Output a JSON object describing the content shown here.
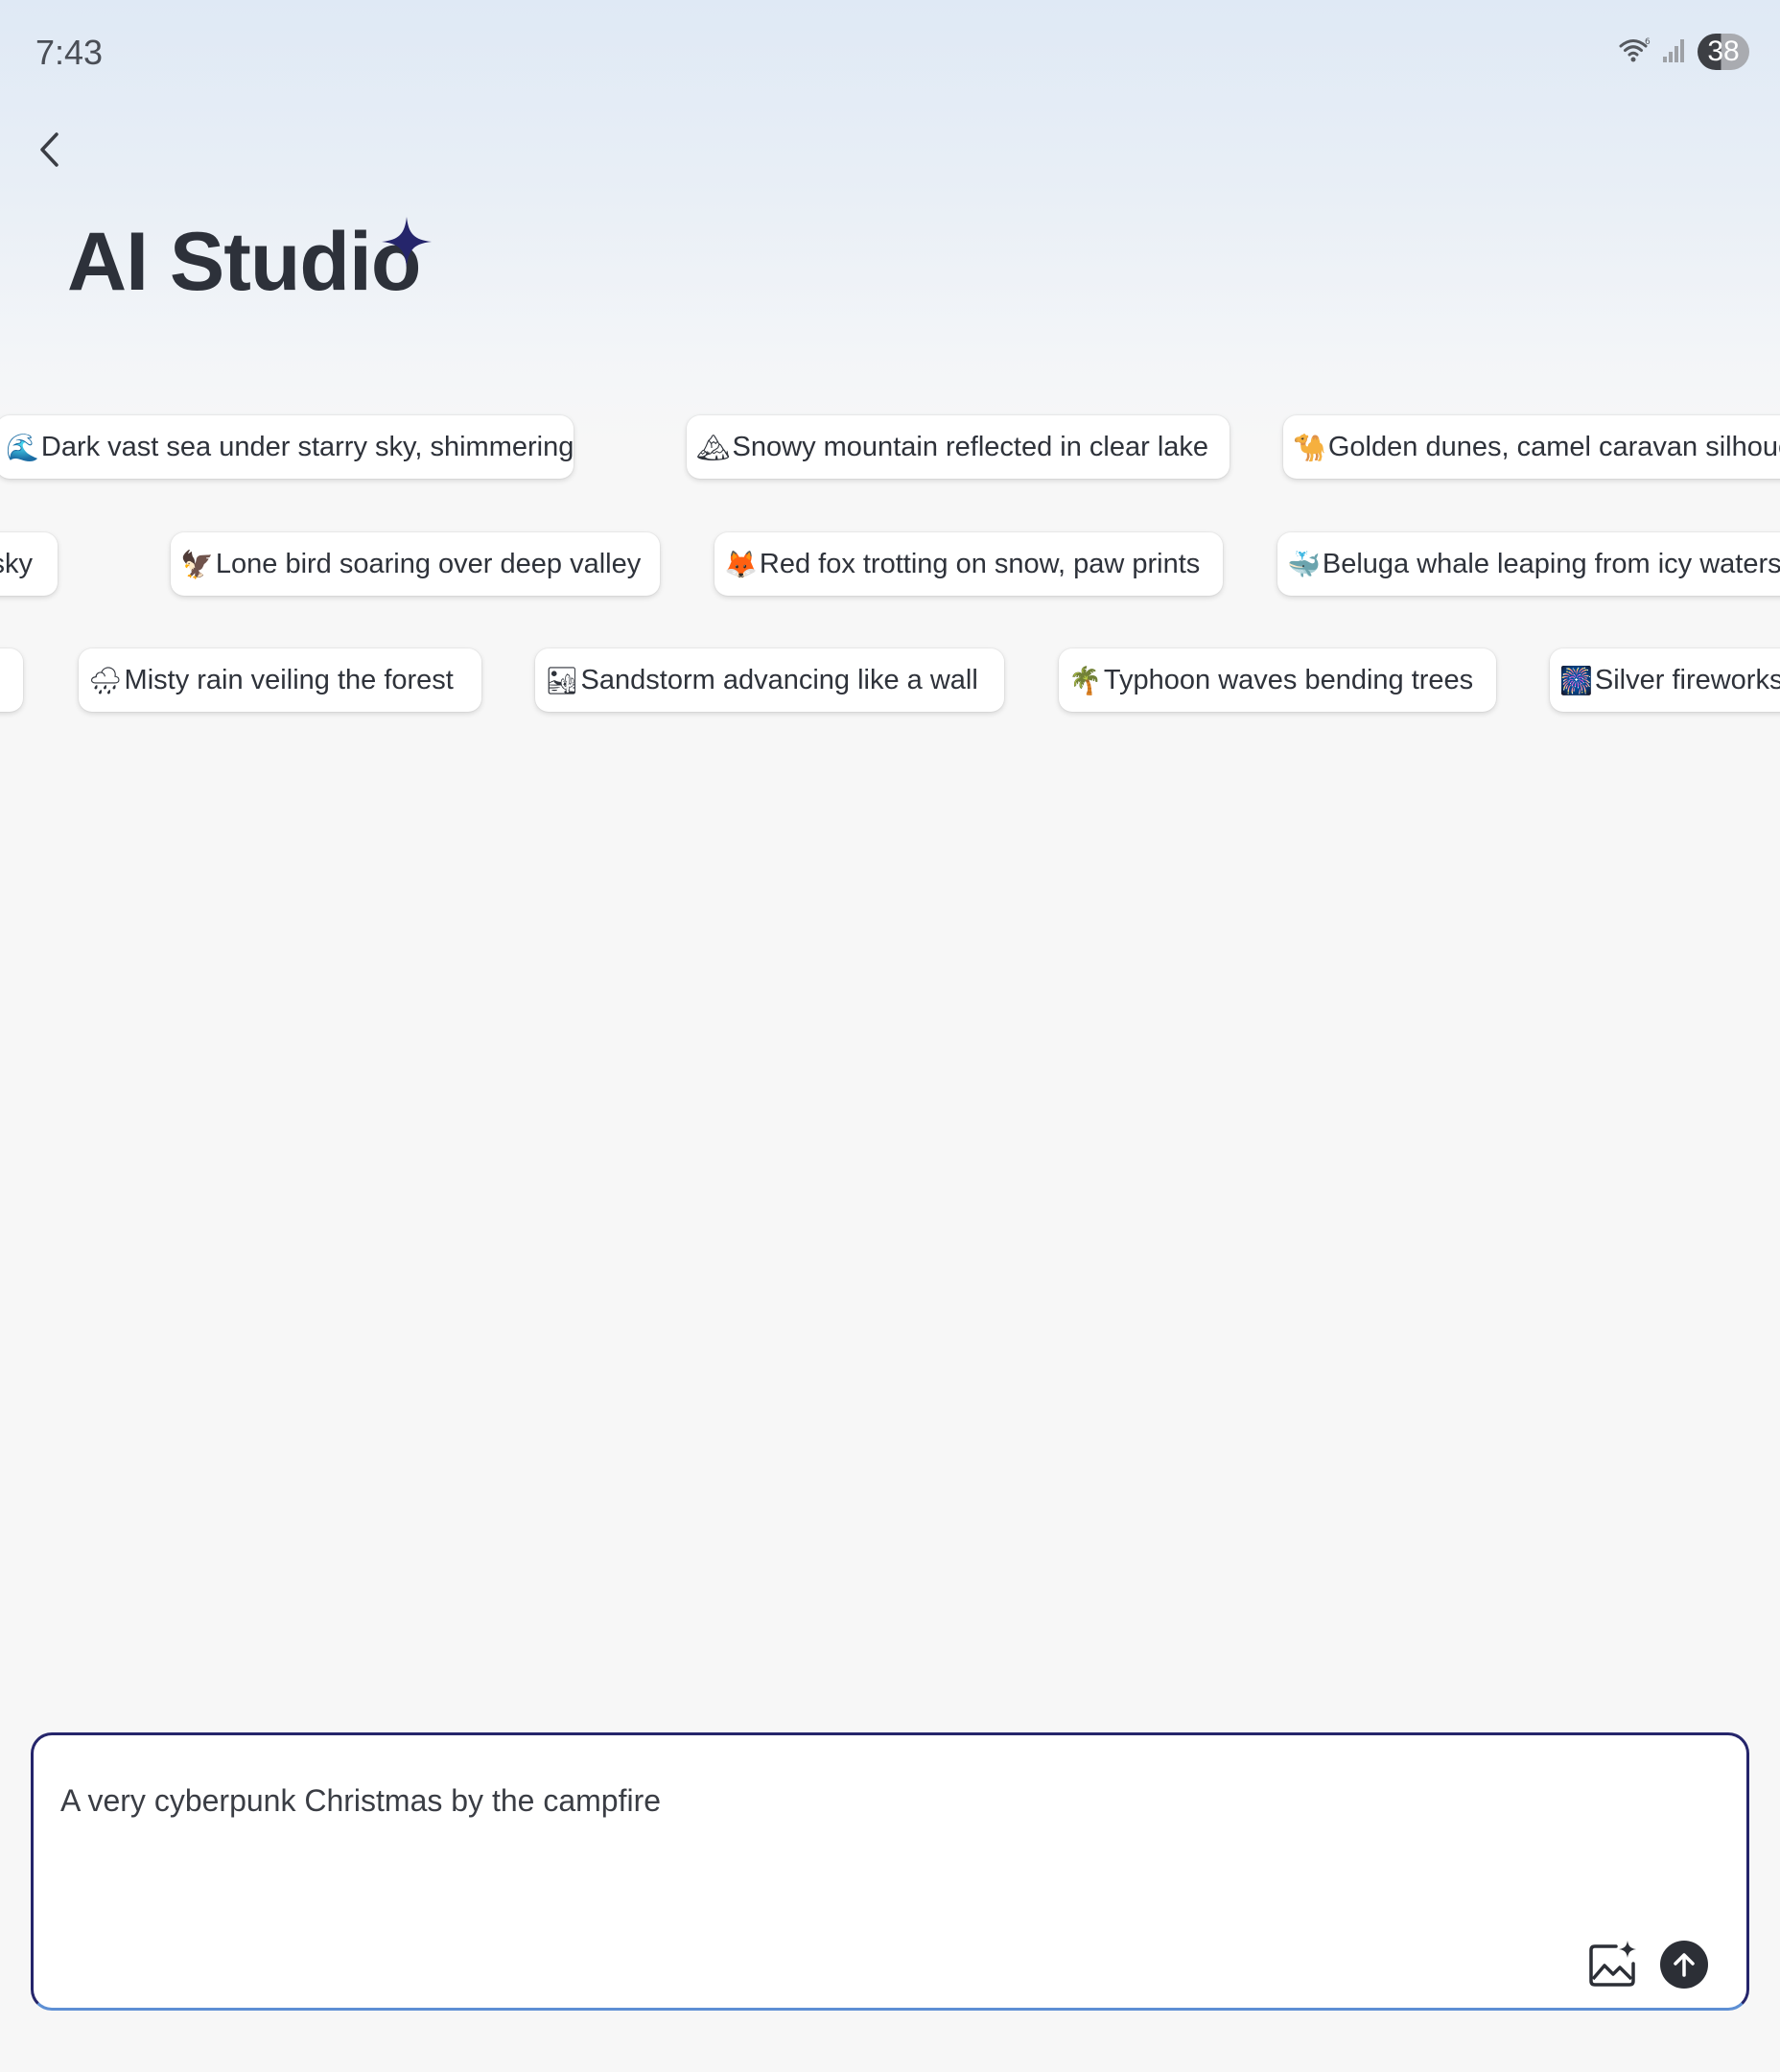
{
  "status_bar": {
    "time": "7:43",
    "battery": "38",
    "icons": [
      "wifi-icon",
      "signal-icon",
      "battery-icon"
    ]
  },
  "header": {
    "back_icon": "chevron-left-icon",
    "title": "AI Studio",
    "title_icon": "sparkle-icon",
    "accent_color": "#25256b"
  },
  "suggestions": {
    "row1": [
      {
        "emoji": "🌊",
        "label": "Dark vast sea under starry sky, shimmering"
      },
      {
        "emoji": "🏔",
        "label": "Snowy mountain reflected in clear lake"
      },
      {
        "emoji": "🐪",
        "label": "Golden dunes, camel caravan silhoue"
      }
    ],
    "row2": [
      {
        "emoji": "",
        "label": "sky"
      },
      {
        "emoji": "🦅",
        "label": "Lone bird soaring over deep valley"
      },
      {
        "emoji": "🦊",
        "label": "Red fox trotting on snow, paw prints"
      },
      {
        "emoji": "🐳",
        "label": "Beluga whale leaping from icy waters"
      }
    ],
    "row3": [
      {
        "emoji": "",
        "label": ""
      },
      {
        "emoji": "🌧",
        "label": "Misty rain veiling the forest"
      },
      {
        "emoji": "🏜",
        "label": "Sandstorm advancing like a wall"
      },
      {
        "emoji": "🌴",
        "label": "Typhoon waves bending trees"
      },
      {
        "emoji": "🎆",
        "label": "Silver fireworks"
      }
    ]
  },
  "prompt": {
    "value": "A very cyberpunk Christmas by the campfire",
    "image_icon": "image-sparkle-icon",
    "send_icon": "arrow-up-icon"
  }
}
